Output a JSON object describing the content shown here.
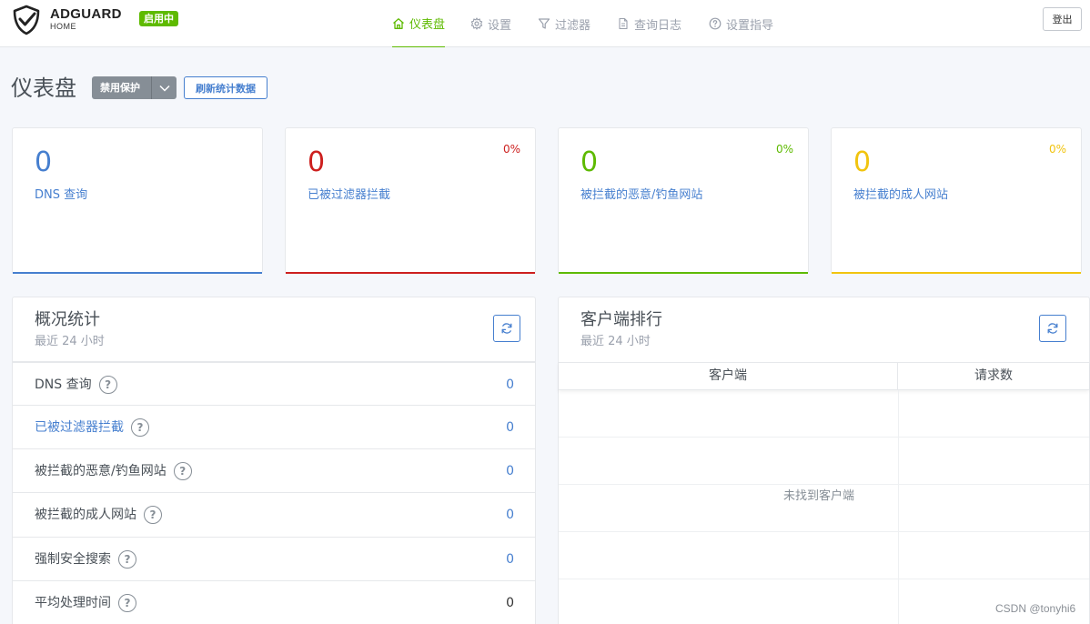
{
  "header": {
    "brand_name": "ADGUARD",
    "brand_sub": "HOME",
    "status_badge": "启用中",
    "nav": [
      {
        "label": "仪表盘",
        "icon": "home-icon",
        "active": true
      },
      {
        "label": "设置",
        "icon": "gear-icon"
      },
      {
        "label": "过滤器",
        "icon": "filter-icon"
      },
      {
        "label": "查询日志",
        "icon": "document-icon"
      },
      {
        "label": "设置指导",
        "icon": "help-circle-icon"
      }
    ],
    "logout_label": "登出"
  },
  "page": {
    "title": "仪表盘",
    "protect_button": "禁用保护",
    "refresh_stats_button": "刷新统计数据"
  },
  "stat_cards": [
    {
      "value": "0",
      "label": "DNS 查询",
      "percent": "",
      "color": "#467fcf"
    },
    {
      "value": "0",
      "label": "已被过滤器拦截",
      "percent": "0%",
      "color": "#cd201f"
    },
    {
      "value": "0",
      "label": "被拦截的恶意/钓鱼网站",
      "percent": "0%",
      "color": "#5eba00"
    },
    {
      "value": "0",
      "label": "被拦截的成人网站",
      "percent": "0%",
      "color": "#f1c40f"
    }
  ],
  "overview": {
    "title": "概况统计",
    "subtitle": "最近 24 小时",
    "rows": [
      {
        "label": "DNS 查询",
        "value": "0"
      },
      {
        "label": "已被过滤器拦截",
        "value": "0"
      },
      {
        "label": "被拦截的恶意/钓鱼网站",
        "value": "0"
      },
      {
        "label": "被拦截的成人网站",
        "value": "0"
      },
      {
        "label": "强制安全搜索",
        "value": "0"
      },
      {
        "label": "平均处理时间",
        "value": "0"
      }
    ]
  },
  "clients": {
    "title": "客户端排行",
    "subtitle": "最近 24 小时",
    "col_client": "客户端",
    "col_requests": "请求数",
    "empty_message": "未找到客户端"
  },
  "watermark": "CSDN @tonyhi6",
  "colors": {
    "accent_green": "#5eba00",
    "link_blue": "#467fcf",
    "red": "#cd201f",
    "yellow": "#f1c40f"
  }
}
